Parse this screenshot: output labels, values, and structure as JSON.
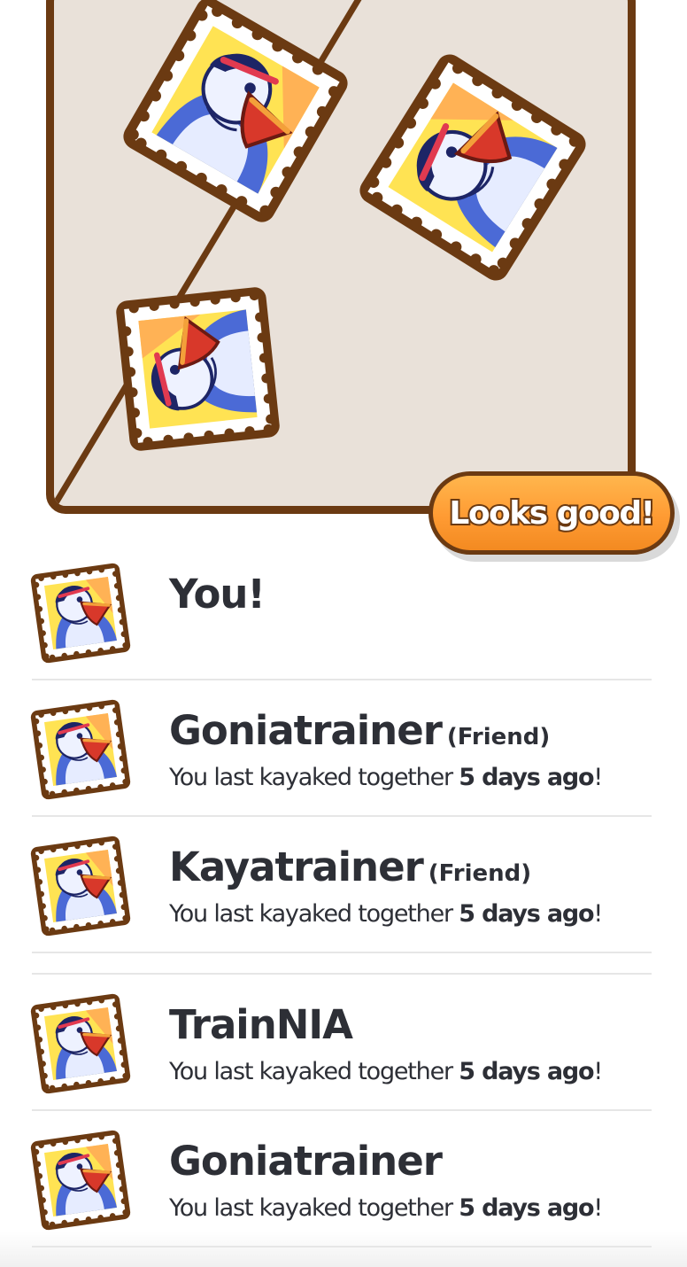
{
  "action_button": {
    "label": "Looks good!"
  },
  "rows": [
    {
      "name": "You!",
      "tag": "",
      "prefix": "",
      "bold": "",
      "suffix": ""
    },
    {
      "name": "Goniatrainer",
      "tag": "(Friend)",
      "prefix": "You last kayaked together ",
      "bold": "5 days ago",
      "suffix": "!"
    },
    {
      "name": "Kayatrainer",
      "tag": "(Friend)",
      "prefix": "You last kayaked together ",
      "bold": "5 days ago",
      "suffix": "!"
    },
    {
      "name": "TrainNIA",
      "tag": "",
      "prefix": "You last kayaked together ",
      "bold": "5 days ago",
      "suffix": "!"
    },
    {
      "name": "Goniatrainer",
      "tag": "",
      "prefix": "You last kayaked together ",
      "bold": "5 days ago",
      "suffix": "!"
    }
  ],
  "icons": {
    "stamp": "toucan-stamp-icon",
    "avatar": "toucan-avatar-icon"
  },
  "colors": {
    "brown": "#6b3a12",
    "board": "#e9e1d9",
    "button": "#ff9b33",
    "text": "#2d2f36",
    "stamp_yellow": "#ffe353",
    "stamp_blue": "#4b6ad6"
  }
}
